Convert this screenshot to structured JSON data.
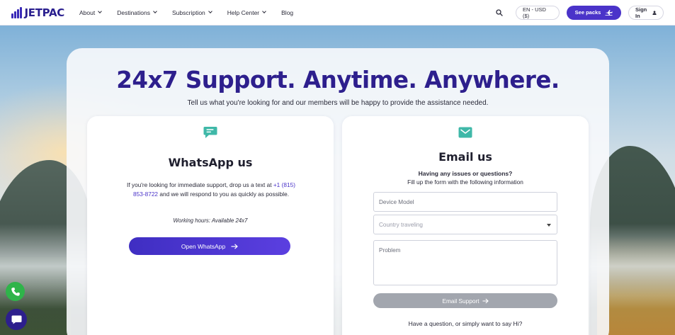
{
  "brand": {
    "name": "JETPAC",
    "color": "#2a1f8f"
  },
  "nav": {
    "items": [
      {
        "label": "About",
        "has_dropdown": true
      },
      {
        "label": "Destinations",
        "has_dropdown": true
      },
      {
        "label": "Subscription",
        "has_dropdown": true
      },
      {
        "label": "Help Center",
        "has_dropdown": true
      },
      {
        "label": "Blog",
        "has_dropdown": false
      }
    ],
    "search_icon": "search-icon",
    "locale_label": "EN - USD ($)",
    "cta_label": "See packs",
    "cta_icon": "plane-icon",
    "signin_label": "Sign In",
    "signin_icon": "user-icon",
    "accent_color": "#4a33c9"
  },
  "hero": {
    "headline": "24x7 Support. Anytime. Anywhere.",
    "subline": "Tell us what you're looking for and our members will be happy to provide the assistance needed."
  },
  "whatsapp": {
    "icon": "chat-bubble-icon",
    "title": "WhatsApp us",
    "text_before": "If you're looking for immediate support, drop us a text at ",
    "phone": "+1 (815) 853-8722",
    "text_after": " and we will respond to you as quickly as possible.",
    "hours": "Working hours: Available 24x7",
    "button_label": "Open WhatsApp",
    "button_icon": "arrow-right-icon"
  },
  "email": {
    "icon": "envelope-icon",
    "title": "Email us",
    "subtitle": "Having any issues or questions?",
    "subtitle2": "Fill up the form with the following information",
    "device_placeholder": "Device Model",
    "country_placeholder": "Country traveling",
    "problem_placeholder": "Problem",
    "button_label": "Email Support",
    "button_icon": "arrow-right-icon",
    "footer_text": "Have a question, or simply want to say Hi?"
  },
  "floating": {
    "whatsapp_icon": "phone-icon",
    "chat_icon": "chat-icon"
  }
}
